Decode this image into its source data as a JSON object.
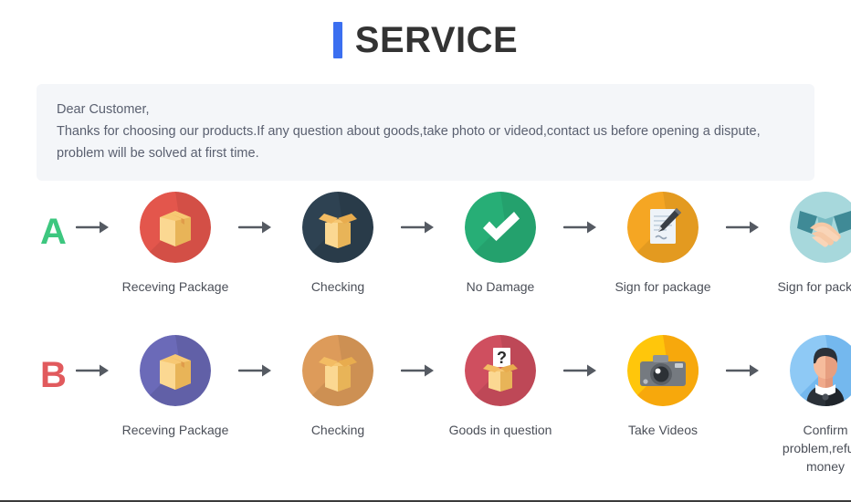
{
  "header": {
    "accent_bar_color": "#3b6ff0",
    "title": "SERVICE"
  },
  "notice": {
    "lines": [
      "Dear Customer,",
      "Thanks for choosing our products.If any question about goods,take photo or videod,contact us before opening a dispute,",
      "problem will be solved at first time."
    ],
    "background_color": "#f4f6f9",
    "text_color": "#5a6070"
  },
  "flows": [
    {
      "letter": "A",
      "letter_color": "#3dc77f",
      "steps": [
        {
          "label": "Receving Package",
          "icon": "closed-box-icon",
          "circle_color": "#e3564c"
        },
        {
          "label": "Checking",
          "icon": "open-box-icon",
          "circle_color": "#2e4252"
        },
        {
          "label": "No Damage",
          "icon": "check-mark-icon",
          "circle_color": "#27ae76"
        },
        {
          "label": "Sign for package",
          "icon": "document-pen-icon",
          "circle_color": "#f5a623"
        },
        {
          "label": "Sign for package",
          "icon": "handshake-icon",
          "circle_color": "#a7d8dc"
        }
      ]
    },
    {
      "letter": "B",
      "letter_color": "#e15a5d",
      "steps": [
        {
          "label": "Receving Package",
          "icon": "closed-box-icon",
          "circle_color": "#6b6ab8"
        },
        {
          "label": "Checking",
          "icon": "open-box-icon",
          "circle_color": "#dd9b5a"
        },
        {
          "label": "Goods in question",
          "icon": "question-box-icon",
          "circle_color": "#cf4f5f"
        },
        {
          "label": "Take Videos",
          "icon": "camera-icon",
          "circle_color": "#ffc60b"
        },
        {
          "label": "Confirm problem,refund money",
          "icon": "person-avatar-icon",
          "circle_color": "#8ec9f5"
        }
      ]
    }
  ],
  "arrow": {
    "name": "right-arrow-icon",
    "color": "#555a62"
  }
}
